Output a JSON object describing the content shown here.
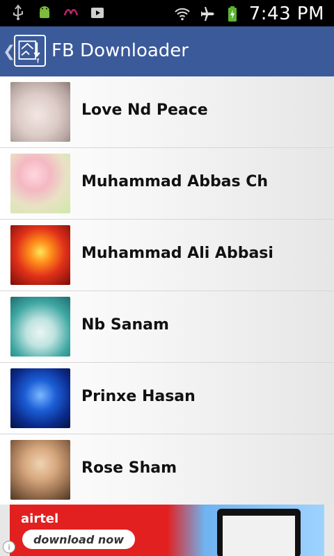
{
  "status_bar": {
    "time": "7:43 PM",
    "icons": [
      "usb-icon",
      "android-icon",
      "app-notification-icon",
      "play-store-icon",
      "wifi-icon",
      "airplane-icon",
      "battery-charging-icon"
    ]
  },
  "action_bar": {
    "title": "FB Downloader"
  },
  "friends": [
    {
      "name": "Love Nd Peace"
    },
    {
      "name": "Muhammad Abbas Ch"
    },
    {
      "name": "Muhammad Ali Abbasi"
    },
    {
      "name": "Nb Sanam"
    },
    {
      "name": "Prinxe Hasan"
    },
    {
      "name": "Rose Sham"
    }
  ],
  "ad": {
    "brand": "airtel",
    "cta": "download now",
    "info_icon": "i"
  },
  "colors": {
    "action_bar": "#3b5a9a",
    "status_bar": "#000000",
    "ad_red": "#e2201f"
  }
}
